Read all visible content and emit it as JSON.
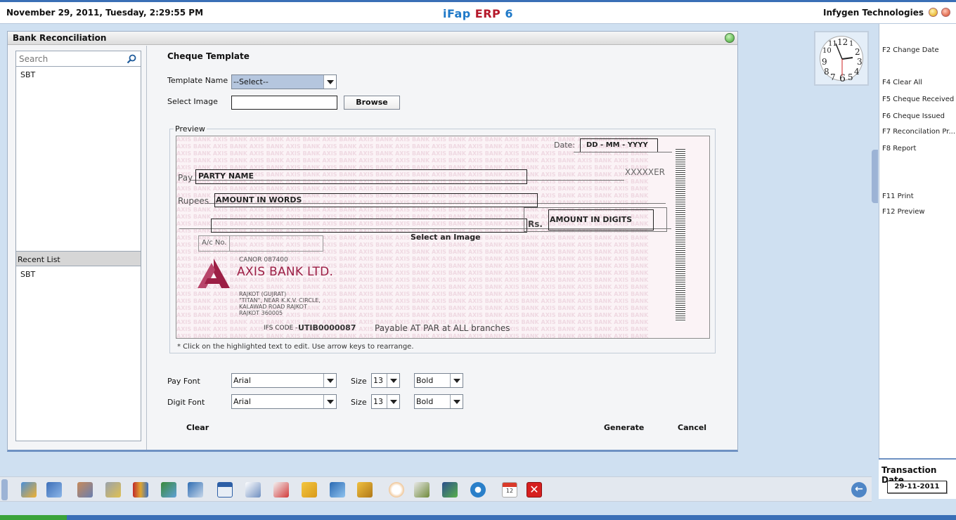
{
  "header": {
    "datetime": "November  29, 2011, Tuesday, 2:29:55 PM",
    "title_a": "iFap",
    "title_b": "ERP",
    "title_c": "6",
    "company": "Infygen Technologies"
  },
  "window": {
    "title": "Bank Reconciliation"
  },
  "left": {
    "search_placeholder": "Search",
    "items": [
      "SBT"
    ],
    "recent_label": "Recent List",
    "recent_items": [
      "SBT"
    ]
  },
  "form": {
    "section_title": "Cheque Template",
    "template_name_label": "Template Name",
    "template_name_value": "--Select--",
    "select_image_label": "Select Image",
    "select_image_value": "",
    "browse_label": "Browse",
    "preview_label": "Preview",
    "hint": "* Click on the highlighted text to edit. Use arrow keys to rearrange.",
    "pay_font_label": "Pay Font",
    "pay_font": "Arial",
    "pay_size_label": "Size",
    "pay_size": "13",
    "pay_style": "Bold",
    "digit_font_label": "Digit Font",
    "digit_font": "Arial",
    "digit_size_label": "Size",
    "digit_size": "13",
    "digit_style": "Bold",
    "clear_label": "Clear",
    "generate_label": "Generate",
    "cancel_label": "Cancel"
  },
  "cheque": {
    "date_label": "Date:",
    "date_box": "DD -  MM - YYYY",
    "pay_label": "Pay",
    "party": "PARTY NAME",
    "bearer": "XXXXXER",
    "rupees_label": "Rupees",
    "amount_words": "AMOUNT IN WORDS",
    "rs_label": "Rs.",
    "amount_digits": "AMOUNT IN DIGITS",
    "select_image": "Select an Image",
    "ac_label": "A/c No.",
    "bank_code": "CANOR   087400",
    "bank_name": "AXIS BANK LTD.",
    "addr1": "RAJKOT (GUJRAT)",
    "addr2": "\"TITAN\", NEAR K.K.V. CIRCLE,",
    "addr3": "KALAWAD ROAD RAJKOT",
    "addr4": "RAJKOT 360005",
    "ifs_label": "IFS CODE -",
    "ifs": "UTIB0000087",
    "payable": "Payable AT PAR at ALL branches",
    "watermark": "AXIS BANK AXIS BANK AXIS BANK AXIS BANK AXIS BANK AXIS BANK AXIS BANK AXIS BANK AXIS BANK AXIS BANK AXIS BANK AXIS BANK AXIS BANK"
  },
  "right": {
    "items": [
      "F2 Change Date",
      "F4 Clear All",
      "F5 Cheque Received",
      "F6 Cheque Issued",
      "F7 Reconcilation Pr...",
      "F8 Report",
      "F11 Print",
      "F12 Preview"
    ],
    "clock_numbers": [
      "12",
      "1",
      "2",
      "3",
      "4",
      "5",
      "6",
      "7",
      "8",
      "9",
      "10",
      "11"
    ],
    "tx_label": "Transaction Date",
    "tx_date": "29-11-2011"
  },
  "taskbar": {
    "icons": [
      "accounts-icon",
      "users-icon",
      "contacts-icon",
      "gears-icon",
      "book-icon",
      "cart-icon",
      "transfer-icon",
      "window-icon",
      "document-icon",
      "chart-icon",
      "folder-tree-icon",
      "network-icon",
      "box-icon",
      "dial-icon",
      "calculator-icon",
      "save-icon",
      "settings-icon",
      "calendar-icon",
      "close-icon"
    ],
    "calendar_day": "12"
  },
  "colors": {
    "accent": "#3a6fb6",
    "brand_red": "#b5192b",
    "brand_blue": "#1f79c8",
    "bank_maroon": "#9c1f45"
  }
}
